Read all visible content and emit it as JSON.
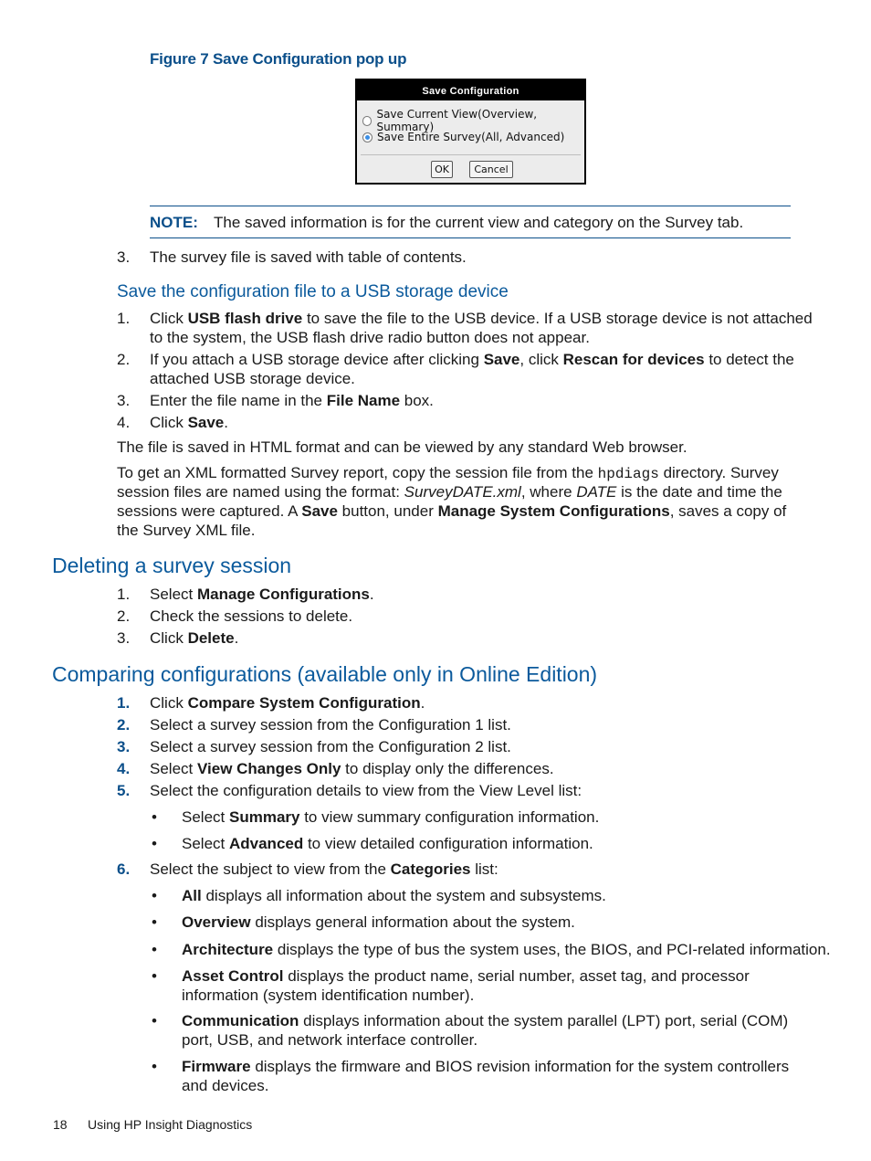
{
  "figure": {
    "caption": "Figure 7 Save Configuration pop up",
    "dialog": {
      "title": "Save Configuration",
      "options": [
        {
          "label": "Save Current View(Overview, Summary)",
          "selected": false
        },
        {
          "label": "Save Entire Survey(All, Advanced)",
          "selected": true
        }
      ],
      "ok_label": "OK",
      "cancel_label": "Cancel",
      "accent_color": "#3a8ee6"
    }
  },
  "note": {
    "label": "NOTE:",
    "text": "The saved information is for the current view and category on the Survey tab."
  },
  "step3": {
    "num": "3.",
    "text": "The survey file is saved with table of contents."
  },
  "usb_section": {
    "heading": "Save the configuration file to a USB storage device",
    "steps": [
      {
        "num": "1.",
        "pre": "Click ",
        "bold": "USB flash drive",
        "post": " to save the file to the USB device. If a USB storage device is not attached",
        "line2": "to the system, the USB flash drive radio button does not appear."
      },
      {
        "num": "2.",
        "pre": "If you attach a USB storage device after clicking ",
        "bold": "Save",
        "mid": ", click ",
        "bold2": "Rescan for devices",
        "post": " to detect the",
        "line2": "attached USB storage device."
      },
      {
        "num": "3.",
        "pre": "Enter the file name in the ",
        "bold": "File Name",
        "post": " box."
      },
      {
        "num": "4.",
        "pre": "Click ",
        "bold": "Save",
        "post": "."
      }
    ],
    "para1": "The file is saved in HTML format and can be viewed by any standard Web browser.",
    "para2": {
      "l1_pre": "To get an XML formatted Survey report, copy the session file from the ",
      "l1_code": "hpdiags",
      "l1_post": " directory. Survey",
      "l2_pre": "session files are named using the format: ",
      "l2_italic1": "SurveyDATE.xml",
      "l2_mid": ", where ",
      "l2_italic2": "DATE",
      "l2_post": " is the date and time the",
      "l3_pre": "sessions were captured. A ",
      "l3_bold1": "Save",
      "l3_mid": " button, under ",
      "l3_bold2": "Manage System Configurations",
      "l3_post": ", saves a copy of",
      "l4": "the Survey XML file."
    }
  },
  "delete_section": {
    "heading": "Deleting a survey session",
    "steps": [
      {
        "num": "1.",
        "pre": "Select ",
        "bold": "Manage Configurations",
        "post": "."
      },
      {
        "num": "2.",
        "pre": "Check the sessions to delete.",
        "bold": "",
        "post": ""
      },
      {
        "num": "3.",
        "pre": "Click ",
        "bold": "Delete",
        "post": "."
      }
    ]
  },
  "compare_section": {
    "heading": "Comparing configurations (available only in Online Edition)",
    "steps": [
      {
        "num": "1.",
        "pre": "Click ",
        "bold": "Compare System Configuration",
        "post": "."
      },
      {
        "num": "2.",
        "pre": "Select a survey session from the Configuration 1 list.",
        "bold": "",
        "post": ""
      },
      {
        "num": "3.",
        "pre": "Select a survey session from the Configuration 2 list.",
        "bold": "",
        "post": ""
      },
      {
        "num": "4.",
        "pre": "Select ",
        "bold": "View Changes Only",
        "post": " to display only the differences."
      },
      {
        "num": "5.",
        "pre": "Select the configuration details to view from the View Level list:",
        "bold": "",
        "post": ""
      },
      {
        "num": "6.",
        "pre": "Select the subject to view from the ",
        "bold": "Categories",
        "post": " list:"
      }
    ],
    "view_levels": [
      {
        "pre": "Select ",
        "bold": "Summary",
        "post": " to view summary configuration information."
      },
      {
        "pre": "Select ",
        "bold": "Advanced",
        "post": " to view detailed configuration information."
      }
    ],
    "categories": [
      {
        "bold": "All",
        "text": " displays all information about the system and subsystems.",
        "line2": ""
      },
      {
        "bold": "Overview",
        "text": " displays general information about the system.",
        "line2": ""
      },
      {
        "bold": "Architecture",
        "text": " displays the type of bus the system uses, the BIOS, and PCI-related information.",
        "line2": ""
      },
      {
        "bold": "Asset Control",
        "text": " displays the product name, serial number, asset tag, and processor",
        "line2": "information (system identification number)."
      },
      {
        "bold": "Communication",
        "text": " displays information about the system parallel (LPT) port, serial (COM)",
        "line2": "port, USB, and network interface controller."
      },
      {
        "bold": "Firmware",
        "text": " displays the firmware and BIOS revision information for the system controllers",
        "line2": "and devices."
      }
    ],
    "bullet_glyph": "•"
  },
  "footer": {
    "page_number": "18",
    "title": "Using HP Insight Diagnostics"
  }
}
